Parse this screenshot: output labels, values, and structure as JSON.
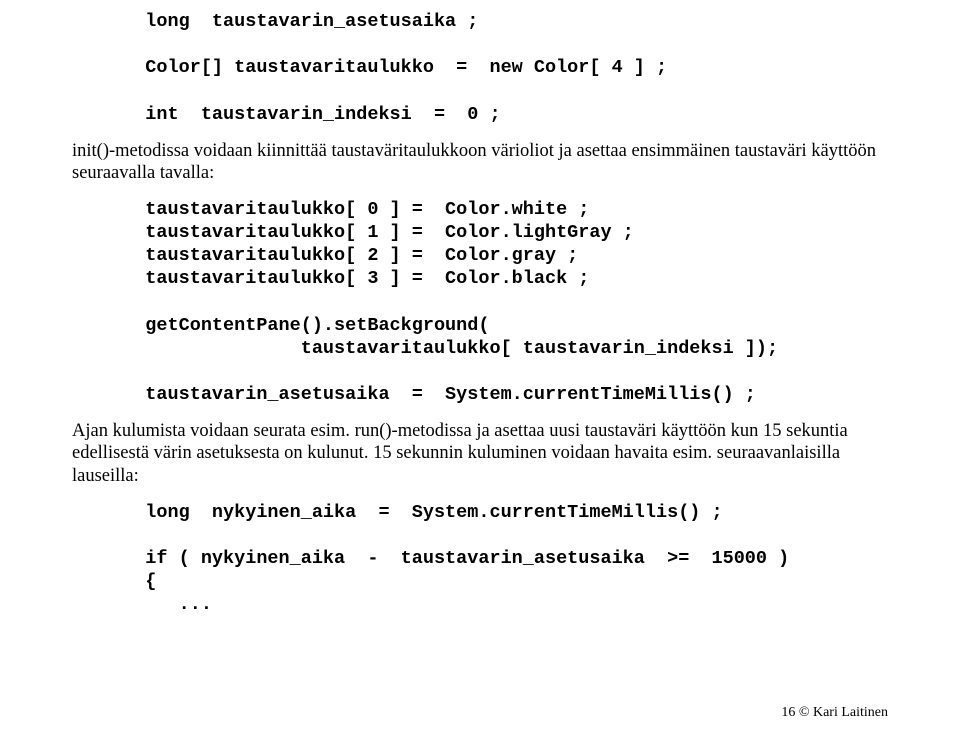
{
  "code1": "   long  taustavarin_asetusaika ;\n\n   Color[] taustavaritaulukko  =  new Color[ 4 ] ;\n\n   int  taustavarin_indeksi  =  0 ;",
  "para1": "init()-metodissa voidaan kiinnittää taustaväritaulukkoon värioliot ja asettaa ensimmäinen taustaväri käyttöön seuraavalla tavalla:",
  "code2": "   taustavaritaulukko[ 0 ] =  Color.white ;\n   taustavaritaulukko[ 1 ] =  Color.lightGray ;\n   taustavaritaulukko[ 2 ] =  Color.gray ;\n   taustavaritaulukko[ 3 ] =  Color.black ;\n\n   getContentPane().setBackground(\n                 taustavaritaulukko[ taustavarin_indeksi ]);\n\n   taustavarin_asetusaika  =  System.currentTimeMillis() ;",
  "para2": "Ajan kulumista voidaan seurata esim. run()-metodissa ja asettaa uusi taustaväri käyttöön kun 15 sekuntia edellisestä värin asetuksesta on kulunut. 15 sekunnin kuluminen voidaan havaita esim. seuraavanlaisilla lauseilla:",
  "code3": "   long  nykyinen_aika  =  System.currentTimeMillis() ;\n\n   if ( nykyinen_aika  -  taustavarin_asetusaika  >=  15000 )\n   {\n      ...",
  "footer": "16 © Kari Laitinen"
}
